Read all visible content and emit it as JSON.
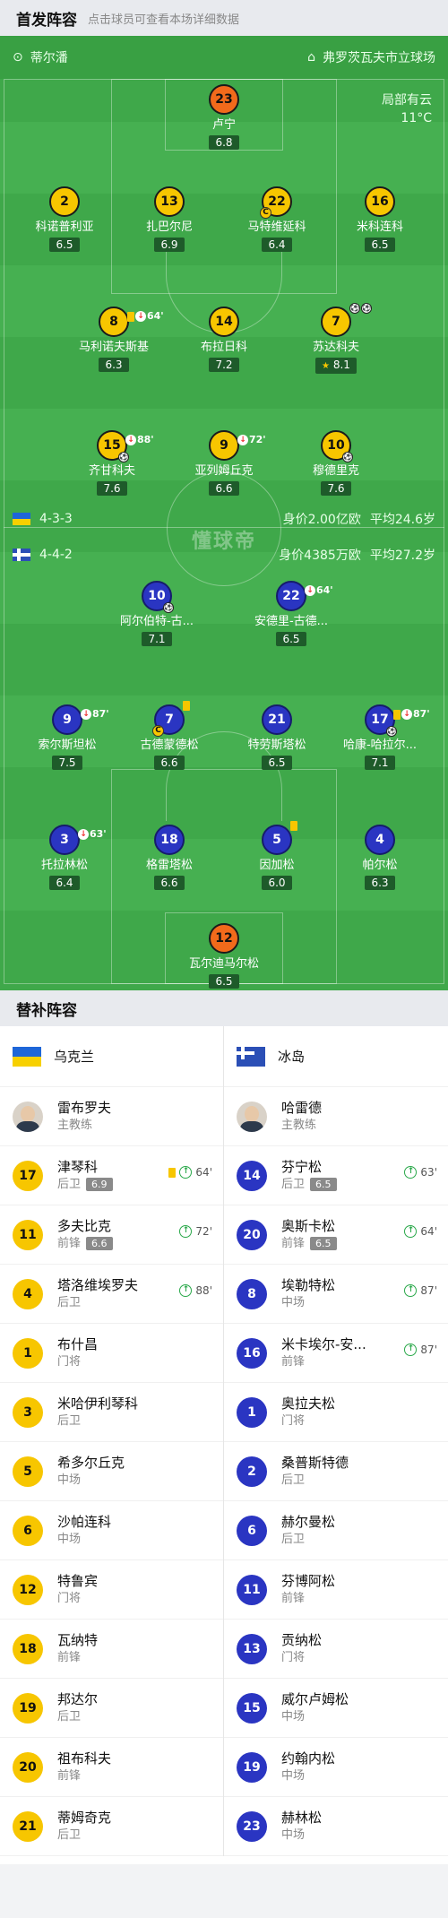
{
  "header": {
    "title": "首发阵容",
    "hint": "点击球员可查看本场详细数据"
  },
  "match": {
    "home_team": "蒂尔潘",
    "venue": "弗罗茨瓦夫市立球场",
    "weather": "局部有云",
    "temp": "11°C"
  },
  "home": {
    "formation": "4-3-3",
    "value": "身价2.00亿欧",
    "avg_age": "平均24.6岁"
  },
  "away": {
    "formation": "4-4-2",
    "value": "身价4385万欧",
    "avg_age": "平均27.2岁"
  },
  "watermark": "懂球帝",
  "home_players": [
    {
      "num": "23",
      "name": "卢宁",
      "rating": "6.8",
      "color": "o"
    },
    {
      "num": "2",
      "name": "科诺普利亚",
      "rating": "6.5",
      "color": "y"
    },
    {
      "num": "13",
      "name": "扎巴尔尼",
      "rating": "6.9",
      "color": "y"
    },
    {
      "num": "22",
      "name": "马特维延科",
      "rating": "6.4",
      "color": "y",
      "captain": "C"
    },
    {
      "num": "16",
      "name": "米科连科",
      "rating": "6.5",
      "color": "y"
    },
    {
      "num": "8",
      "name": "马利诺夫斯基",
      "rating": "6.3",
      "color": "y",
      "ev_min": "64'"
    },
    {
      "num": "14",
      "name": "布拉日科",
      "rating": "7.2",
      "color": "y"
    },
    {
      "num": "7",
      "name": "苏达科夫",
      "rating": "8.1",
      "color": "y"
    },
    {
      "num": "15",
      "name": "齐甘科夫",
      "rating": "7.6",
      "color": "y",
      "ev_min": "88'"
    },
    {
      "num": "9",
      "name": "亚列姆丘克",
      "rating": "6.6",
      "color": "y",
      "ev_min": "72'"
    },
    {
      "num": "10",
      "name": "穆德里克",
      "rating": "7.6",
      "color": "y"
    }
  ],
  "away_players": [
    {
      "num": "10",
      "name": "阿尔伯特-古...",
      "rating": "7.1",
      "color": "b"
    },
    {
      "num": "22",
      "name": "安德里-古德...",
      "rating": "6.5",
      "color": "b",
      "ev_min": "64'"
    },
    {
      "num": "9",
      "name": "索尔斯坦松",
      "rating": "7.5",
      "color": "b",
      "ev_min": "87'"
    },
    {
      "num": "7",
      "name": "古德蒙德松",
      "rating": "6.6",
      "color": "b",
      "captain": "C"
    },
    {
      "num": "21",
      "name": "特劳斯塔松",
      "rating": "6.5",
      "color": "b"
    },
    {
      "num": "17",
      "name": "哈康-哈拉尔...",
      "rating": "7.1",
      "color": "b",
      "ev_min": "87'"
    },
    {
      "num": "3",
      "name": "托拉林松",
      "rating": "6.4",
      "color": "b",
      "ev_min": "63'"
    },
    {
      "num": "18",
      "name": "格雷塔松",
      "rating": "6.6",
      "color": "b"
    },
    {
      "num": "5",
      "name": "因加松",
      "rating": "6.0",
      "color": "b"
    },
    {
      "num": "4",
      "name": "帕尔松",
      "rating": "6.3",
      "color": "b"
    },
    {
      "num": "12",
      "name": "瓦尔迪马尔松",
      "rating": "6.5",
      "color": "o"
    }
  ],
  "subs_header": "替补阵容",
  "ukraine": {
    "team": "乌克兰",
    "coach": "雷布罗夫",
    "coach_role": "主教练",
    "subs": [
      {
        "num": "17",
        "name": "津琴科",
        "pos": "后卫",
        "rating": "6.9",
        "min": "64'",
        "card": true
      },
      {
        "num": "11",
        "name": "多夫比克",
        "pos": "前锋",
        "rating": "6.6",
        "min": "72'"
      },
      {
        "num": "4",
        "name": "塔洛维埃罗夫",
        "pos": "后卫",
        "rating": "",
        "min": "88'"
      },
      {
        "num": "1",
        "name": "布什昌",
        "pos": "门将",
        "rating": "",
        "min": ""
      },
      {
        "num": "3",
        "name": "米哈伊利琴科",
        "pos": "后卫",
        "rating": "",
        "min": ""
      },
      {
        "num": "5",
        "name": "希多尔丘克",
        "pos": "中场",
        "rating": "",
        "min": ""
      },
      {
        "num": "6",
        "name": "沙帕连科",
        "pos": "中场",
        "rating": "",
        "min": ""
      },
      {
        "num": "12",
        "name": "特鲁宾",
        "pos": "门将",
        "rating": "",
        "min": ""
      },
      {
        "num": "18",
        "name": "瓦纳特",
        "pos": "前锋",
        "rating": "",
        "min": ""
      },
      {
        "num": "19",
        "name": "邦达尔",
        "pos": "后卫",
        "rating": "",
        "min": ""
      },
      {
        "num": "20",
        "name": "祖布科夫",
        "pos": "前锋",
        "rating": "",
        "min": ""
      },
      {
        "num": "21",
        "name": "蒂姆奇克",
        "pos": "后卫",
        "rating": "",
        "min": ""
      }
    ]
  },
  "iceland": {
    "team": "冰岛",
    "coach": "哈雷德",
    "coach_role": "主教练",
    "subs": [
      {
        "num": "14",
        "name": "芬宁松",
        "pos": "后卫",
        "rating": "6.5",
        "min": "63'"
      },
      {
        "num": "20",
        "name": "奥斯卡松",
        "pos": "前锋",
        "rating": "6.5",
        "min": "64'"
      },
      {
        "num": "8",
        "name": "埃勒特松",
        "pos": "中场",
        "rating": "",
        "min": "87'"
      },
      {
        "num": "16",
        "name": "米卡埃尔-安...",
        "pos": "前锋",
        "rating": "",
        "min": "87'"
      },
      {
        "num": "1",
        "name": "奥拉夫松",
        "pos": "门将",
        "rating": "",
        "min": ""
      },
      {
        "num": "2",
        "name": "桑普斯特德",
        "pos": "后卫",
        "rating": "",
        "min": ""
      },
      {
        "num": "6",
        "name": "赫尔曼松",
        "pos": "后卫",
        "rating": "",
        "min": ""
      },
      {
        "num": "11",
        "name": "芬博阿松",
        "pos": "前锋",
        "rating": "",
        "min": ""
      },
      {
        "num": "13",
        "name": "贡纳松",
        "pos": "门将",
        "rating": "",
        "min": ""
      },
      {
        "num": "15",
        "name": "威尔卢姆松",
        "pos": "中场",
        "rating": "",
        "min": ""
      },
      {
        "num": "19",
        "name": "约翰内松",
        "pos": "中场",
        "rating": "",
        "min": ""
      },
      {
        "num": "23",
        "name": "赫林松",
        "pos": "中场",
        "rating": "",
        "min": ""
      }
    ]
  }
}
